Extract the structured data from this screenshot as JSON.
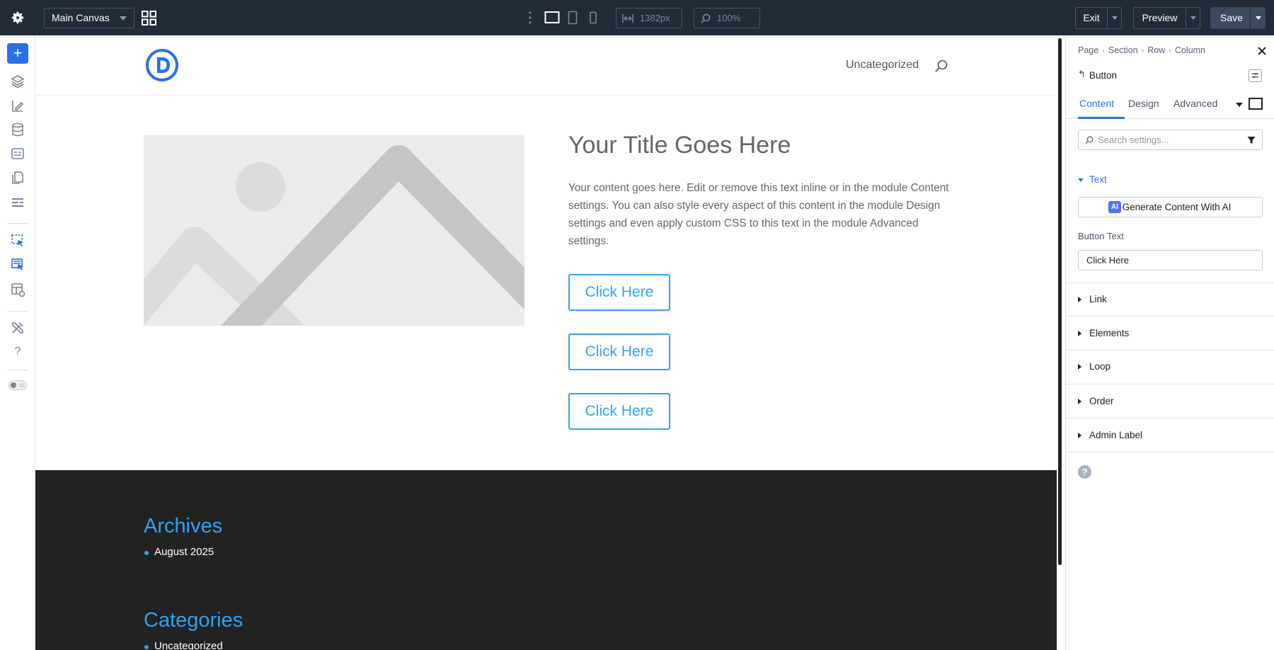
{
  "topbar": {
    "canvas_select": "Main Canvas",
    "width_value": "1382px",
    "zoom_value": "100%",
    "exit_label": "Exit",
    "preview_label": "Preview",
    "save_label": "Save"
  },
  "leftbar": {
    "icons": [
      "add-icon",
      "layers-icon",
      "theme-builder-icon",
      "database-icon",
      "layout-icon",
      "pages-icon",
      "sections-icon",
      "select-element-icon",
      "multi-select-icon",
      "preview-icon",
      "tools-icon",
      "help-icon",
      "theme-toggle-icon"
    ]
  },
  "site": {
    "menu_item": "Uncategorized",
    "hero_title": "Your Title Goes Here",
    "hero_text": "Your content goes here. Edit or remove this text inline or in the module Content settings. You can also style every aspect of this content in the module Design settings and even apply custom CSS to this text in the module Advanced settings.",
    "buttons": [
      "Click Here",
      "Click Here",
      "Click Here"
    ],
    "footer": {
      "archives_title": "Archives",
      "archives_item": "August 2025",
      "categories_title": "Categories",
      "categories_item": "Uncategorized"
    }
  },
  "panel": {
    "breadcrumbs": [
      "Page",
      "Section",
      "Row",
      "Column"
    ],
    "module_name": "Button",
    "tabs": [
      "Content",
      "Design",
      "Advanced"
    ],
    "search_placeholder": "Search settings...",
    "group_text": "Text",
    "ai_button": "Generate Content With AI",
    "ai_badge": "AI",
    "button_text_label": "Button Text",
    "button_text_value": "Click Here",
    "groups": [
      "Link",
      "Elements",
      "Loop",
      "Order",
      "Admin Label"
    ],
    "help": "?"
  },
  "colors": {
    "topbar_bg": "#222b38",
    "accent": "#2b6fe8",
    "site_link": "#2ea3f2",
    "footer_bg": "#222222"
  }
}
